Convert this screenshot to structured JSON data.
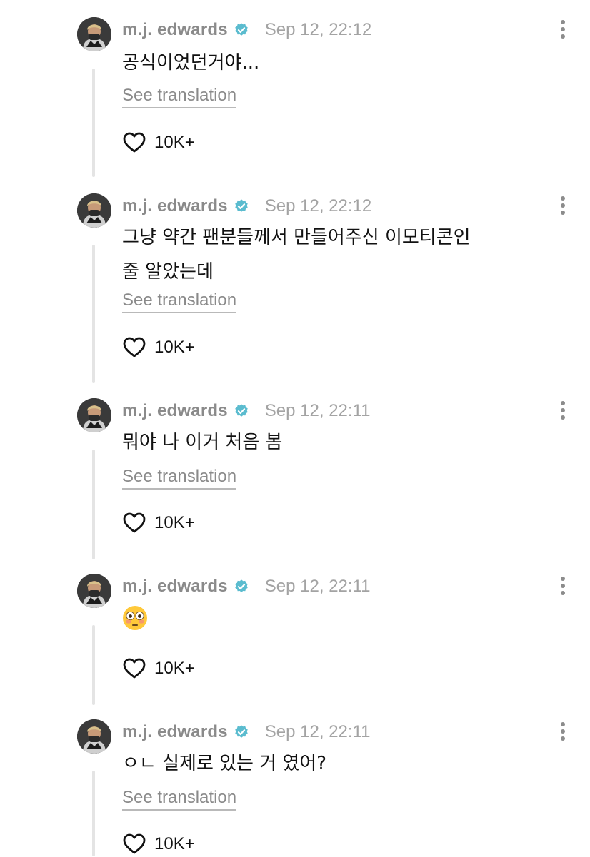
{
  "posts": [
    {
      "username": "m.j. edwards",
      "timestamp": "Sep 12, 22:12",
      "text": "공식이었던거야...",
      "translate_label": "See translation",
      "likes": "10K+"
    },
    {
      "username": "m.j. edwards",
      "timestamp": "Sep 12, 22:12",
      "text": "그냥 약간 팬분들께서 만들어주신 이모티콘인\n줄 알았는데",
      "translate_label": "See translation",
      "likes": "10K+"
    },
    {
      "username": "m.j. edwards",
      "timestamp": "Sep 12, 22:11",
      "text": "뭐야 나 이거 처음 봄",
      "translate_label": "See translation",
      "likes": "10K+"
    },
    {
      "username": "m.j. edwards",
      "timestamp": "Sep 12, 22:11",
      "emoji": "flushed-face-emoji",
      "likes": "10K+"
    },
    {
      "username": "m.j. edwards",
      "timestamp": "Sep 12, 22:11",
      "text": "ㅇㄴ 실제로 있는 거 였어?",
      "translate_label": "See translation",
      "likes": "10K+"
    }
  ],
  "icons": {
    "verified": "verified-badge-icon",
    "more": "more-options-icon",
    "like": "heart-icon"
  },
  "colors": {
    "verified_badge": "#5bbccf",
    "username": "#8a8a8a",
    "timestamp": "#a3a3a3",
    "thread_line": "#e4e4e4"
  }
}
